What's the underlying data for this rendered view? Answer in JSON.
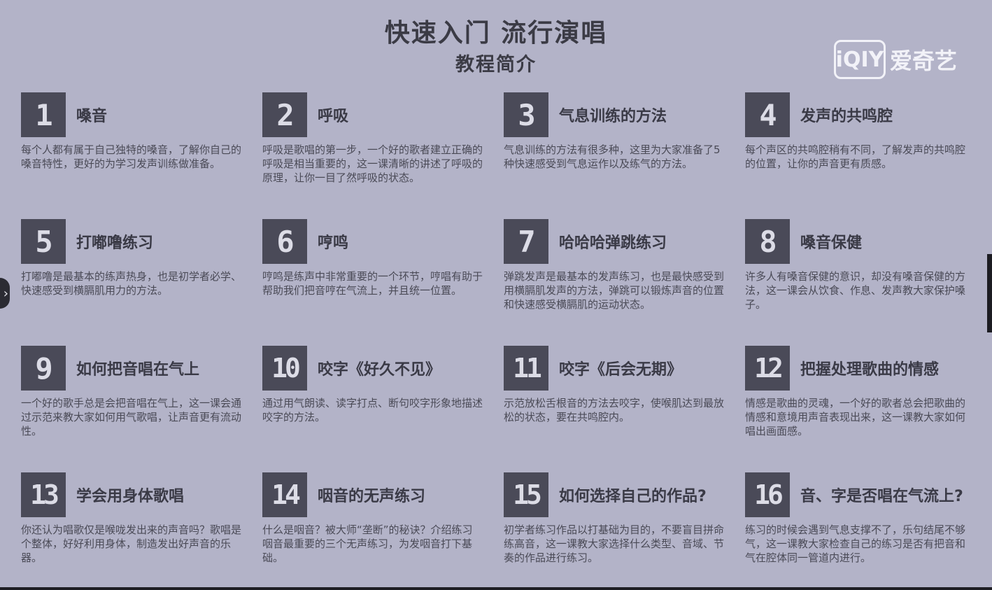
{
  "header": {
    "title": "快速入门 流行演唱",
    "subtitle": "教程简介"
  },
  "watermark": {
    "logo": "iQIY",
    "brand": "爱奇艺"
  },
  "lessons": [
    {
      "num": "1",
      "title": "嗓音",
      "desc": "每个人都有属于自己独特的嗓音，了解你自己的嗓音特性，更好的为学习发声训练做准备。"
    },
    {
      "num": "2",
      "title": "呼吸",
      "desc": "呼吸是歌唱的第一步，一个好的歌者建立正确的呼吸是相当重要的，这一课清晰的讲述了呼吸的原理，让你一目了然呼吸的状态。"
    },
    {
      "num": "3",
      "title": "气息训练的方法",
      "desc": "气息训练的方法有很多种，这里为大家准备了5种快速感受到气息运作以及练气的方法。"
    },
    {
      "num": "4",
      "title": "发声的共鸣腔",
      "desc": "每个声区的共鸣腔稍有不同，了解发声的共鸣腔的位置，让你的声音更有质感。"
    },
    {
      "num": "5",
      "title": "打嘟噜练习",
      "desc": "打嘟噜是最基本的练声热身，也是初学者必学、快速感受到横膈肌用力的方法。"
    },
    {
      "num": "6",
      "title": "哼鸣",
      "desc": "哼鸣是练声中非常重要的一个环节，哼唱有助于帮助我们把音哼在气流上，并且统一位置。"
    },
    {
      "num": "7",
      "title": "哈哈哈弹跳练习",
      "desc": "弹跳发声是最基本的发声练习，也是最快感受到用横膈肌发声的方法，弹跳可以锻炼声音的位置和快速感受横膈肌的运动状态。"
    },
    {
      "num": "8",
      "title": "嗓音保健",
      "desc": "许多人有嗓音保健的意识，却没有嗓音保健的方法，这一课会从饮食、作息、发声教大家保护嗓子。"
    },
    {
      "num": "9",
      "title": "如何把音唱在气上",
      "desc": "一个好的歌手总是会把音唱在气上，这一课会通过示范来教大家如何用气歌唱，让声音更有流动性。"
    },
    {
      "num": "10",
      "title": "咬字《好久不见》",
      "desc": "通过用气朗读、读字打点、断句咬字形象地描述咬字的方法。"
    },
    {
      "num": "11",
      "title": "咬字《后会无期》",
      "desc": "示范放松舌根音的方法去咬字，使喉肌达到最放松的状态，要在共鸣腔内。"
    },
    {
      "num": "12",
      "title": "把握处理歌曲的情感",
      "desc": "情感是歌曲的灵魂，一个好的歌者总会把歌曲的情感和意境用声音表现出来，这一课教大家如何唱出画面感。"
    },
    {
      "num": "13",
      "title": "学会用身体歌唱",
      "desc": "你还认为唱歌仅是喉咙发出来的声音吗？歌唱是个整体，好好利用身体，制造发出好声音的乐器。"
    },
    {
      "num": "14",
      "title": "咽音的无声练习",
      "desc": "什么是咽音？被大师“垄断”的秘诀？介绍练习咽音最重要的三个无声练习，为发咽音打下基础。"
    },
    {
      "num": "15",
      "title": "如何选择自己的作品?",
      "desc": "初学者练习作品以打基础为目的，不要盲目拼命练高音，这一课教大家选择什么类型、音域、节奏的作品进行练习。"
    },
    {
      "num": "16",
      "title": "音、字是否唱在气流上?",
      "desc": "练习的时候会遇到气息支撑不了，乐句结尾不够气，这一课教大家检查自己的练习是否有把音和气在腔体同一管道内进行。"
    }
  ]
}
